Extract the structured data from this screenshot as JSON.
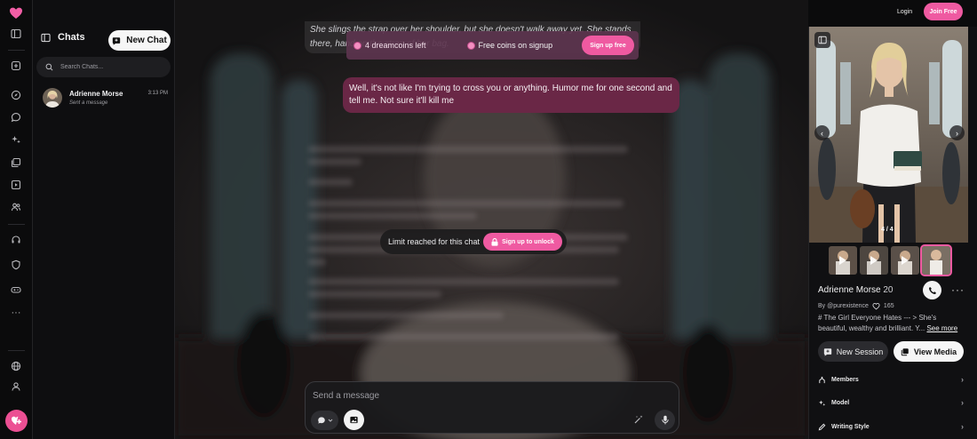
{
  "app": {
    "brand_color": "#ec4f93"
  },
  "rail": {
    "icons": [
      "heart-logo-icon",
      "sidebar-toggle-icon",
      "plus-square-icon",
      "compass-icon",
      "chat-bubble-icon",
      "sparkles-icon",
      "gallery-icon",
      "video-icon",
      "users-icon",
      "headset-icon",
      "shield-icon",
      "gamepad-icon",
      "ellipsis-icon",
      "globe-icon",
      "profile-icon",
      "heart-add-icon"
    ]
  },
  "list": {
    "title": "Chats",
    "new_chat": "New Chat",
    "search_placeholder": "Search Chats...",
    "chats": [
      {
        "name": "Adrienne Morse",
        "time": "3:13 PM",
        "preview": "Sent a message"
      }
    ]
  },
  "main": {
    "prev_message": "She slings the strap over her shoulder, but she doesn't walk away yet. She stands there, hand on the strap of her bag.",
    "coin_banner": {
      "coins": "4 dreamcoins left",
      "free": "Free coins on signup",
      "button": "Sign up free"
    },
    "user_message": "Well, it's not like I'm trying to cross you or anything. Humor me for one second and tell me. Not sure it'll kill me",
    "limit": {
      "text": "Limit reached for this chat",
      "button": "Sign up to unlock"
    },
    "composer_placeholder": "Send a message"
  },
  "topbar": {
    "login": "Login",
    "join": "Join Free"
  },
  "panel": {
    "image_counter": "4 / 4",
    "name": "Adrienne Morse",
    "age": "20",
    "author": "By @purexistence",
    "likes": "165",
    "description": "# The Girl Everyone Hates --- > She's beautiful, wealthy and brilliant. Y...",
    "see_more": "See more",
    "new_session": "New Session",
    "view_media": "View Media",
    "menu": [
      {
        "label": "Members",
        "icon": "members-icon"
      },
      {
        "label": "Model",
        "icon": "model-icon"
      },
      {
        "label": "Writing Style",
        "icon": "pen-icon"
      }
    ]
  }
}
